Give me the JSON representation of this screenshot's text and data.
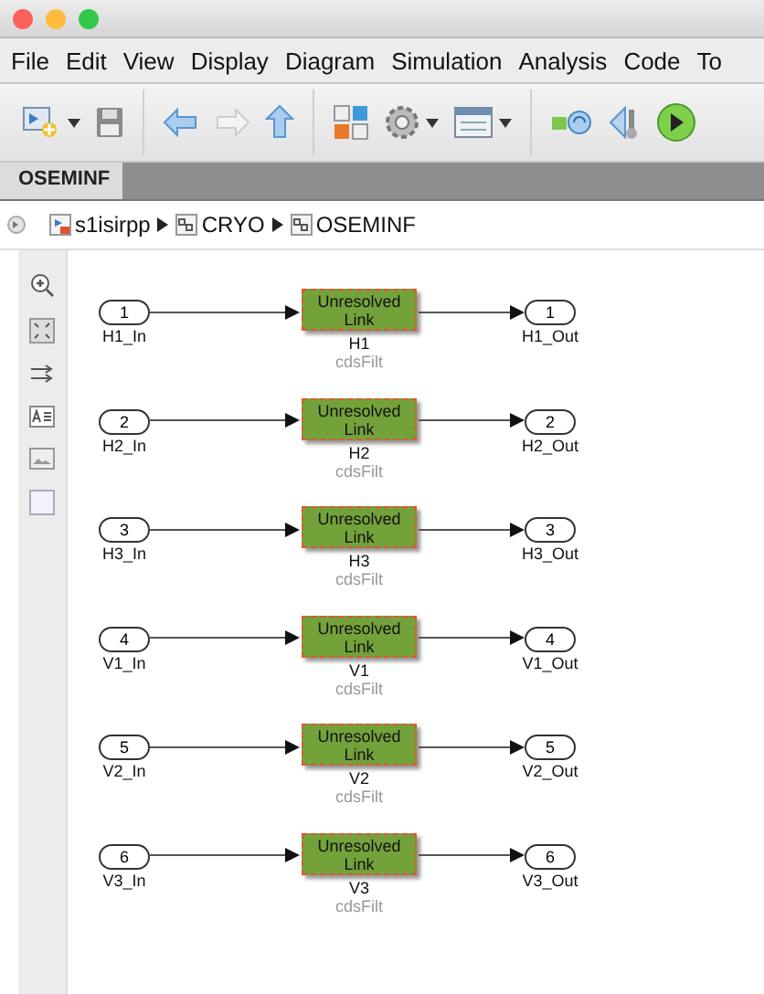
{
  "menu": [
    "File",
    "Edit",
    "View",
    "Display",
    "Diagram",
    "Simulation",
    "Analysis",
    "Code",
    "To"
  ],
  "tabs": [
    {
      "label": "OSEMINF",
      "selected": true
    }
  ],
  "breadcrumb": [
    "s1isirpp",
    "CRYO",
    "OSEMINF"
  ],
  "rows": [
    {
      "in_port": "1",
      "in_label": "H1_In",
      "block_text": "Unresolved Link",
      "block_name": "H1",
      "block_source": "cdsFilt",
      "out_port": "1",
      "out_label": "H1_Out"
    },
    {
      "in_port": "2",
      "in_label": "H2_In",
      "block_text": "Unresolved Link",
      "block_name": "H2",
      "block_source": "cdsFilt",
      "out_port": "2",
      "out_label": "H2_Out"
    },
    {
      "in_port": "3",
      "in_label": "H3_In",
      "block_text": "Unresolved Link",
      "block_name": "H3",
      "block_source": "cdsFilt",
      "out_port": "3",
      "out_label": "H3_Out"
    },
    {
      "in_port": "4",
      "in_label": "V1_In",
      "block_text": "Unresolved Link",
      "block_name": "V1",
      "block_source": "cdsFilt",
      "out_port": "4",
      "out_label": "V1_Out"
    },
    {
      "in_port": "5",
      "in_label": "V2_In",
      "block_text": "Unresolved Link",
      "block_name": "V2",
      "block_source": "cdsFilt",
      "out_port": "5",
      "out_label": "V2_Out"
    },
    {
      "in_port": "6",
      "in_label": "V3_In",
      "block_text": "Unresolved Link",
      "block_name": "V3",
      "block_source": "cdsFilt",
      "out_port": "6",
      "out_label": "V3_Out"
    }
  ]
}
